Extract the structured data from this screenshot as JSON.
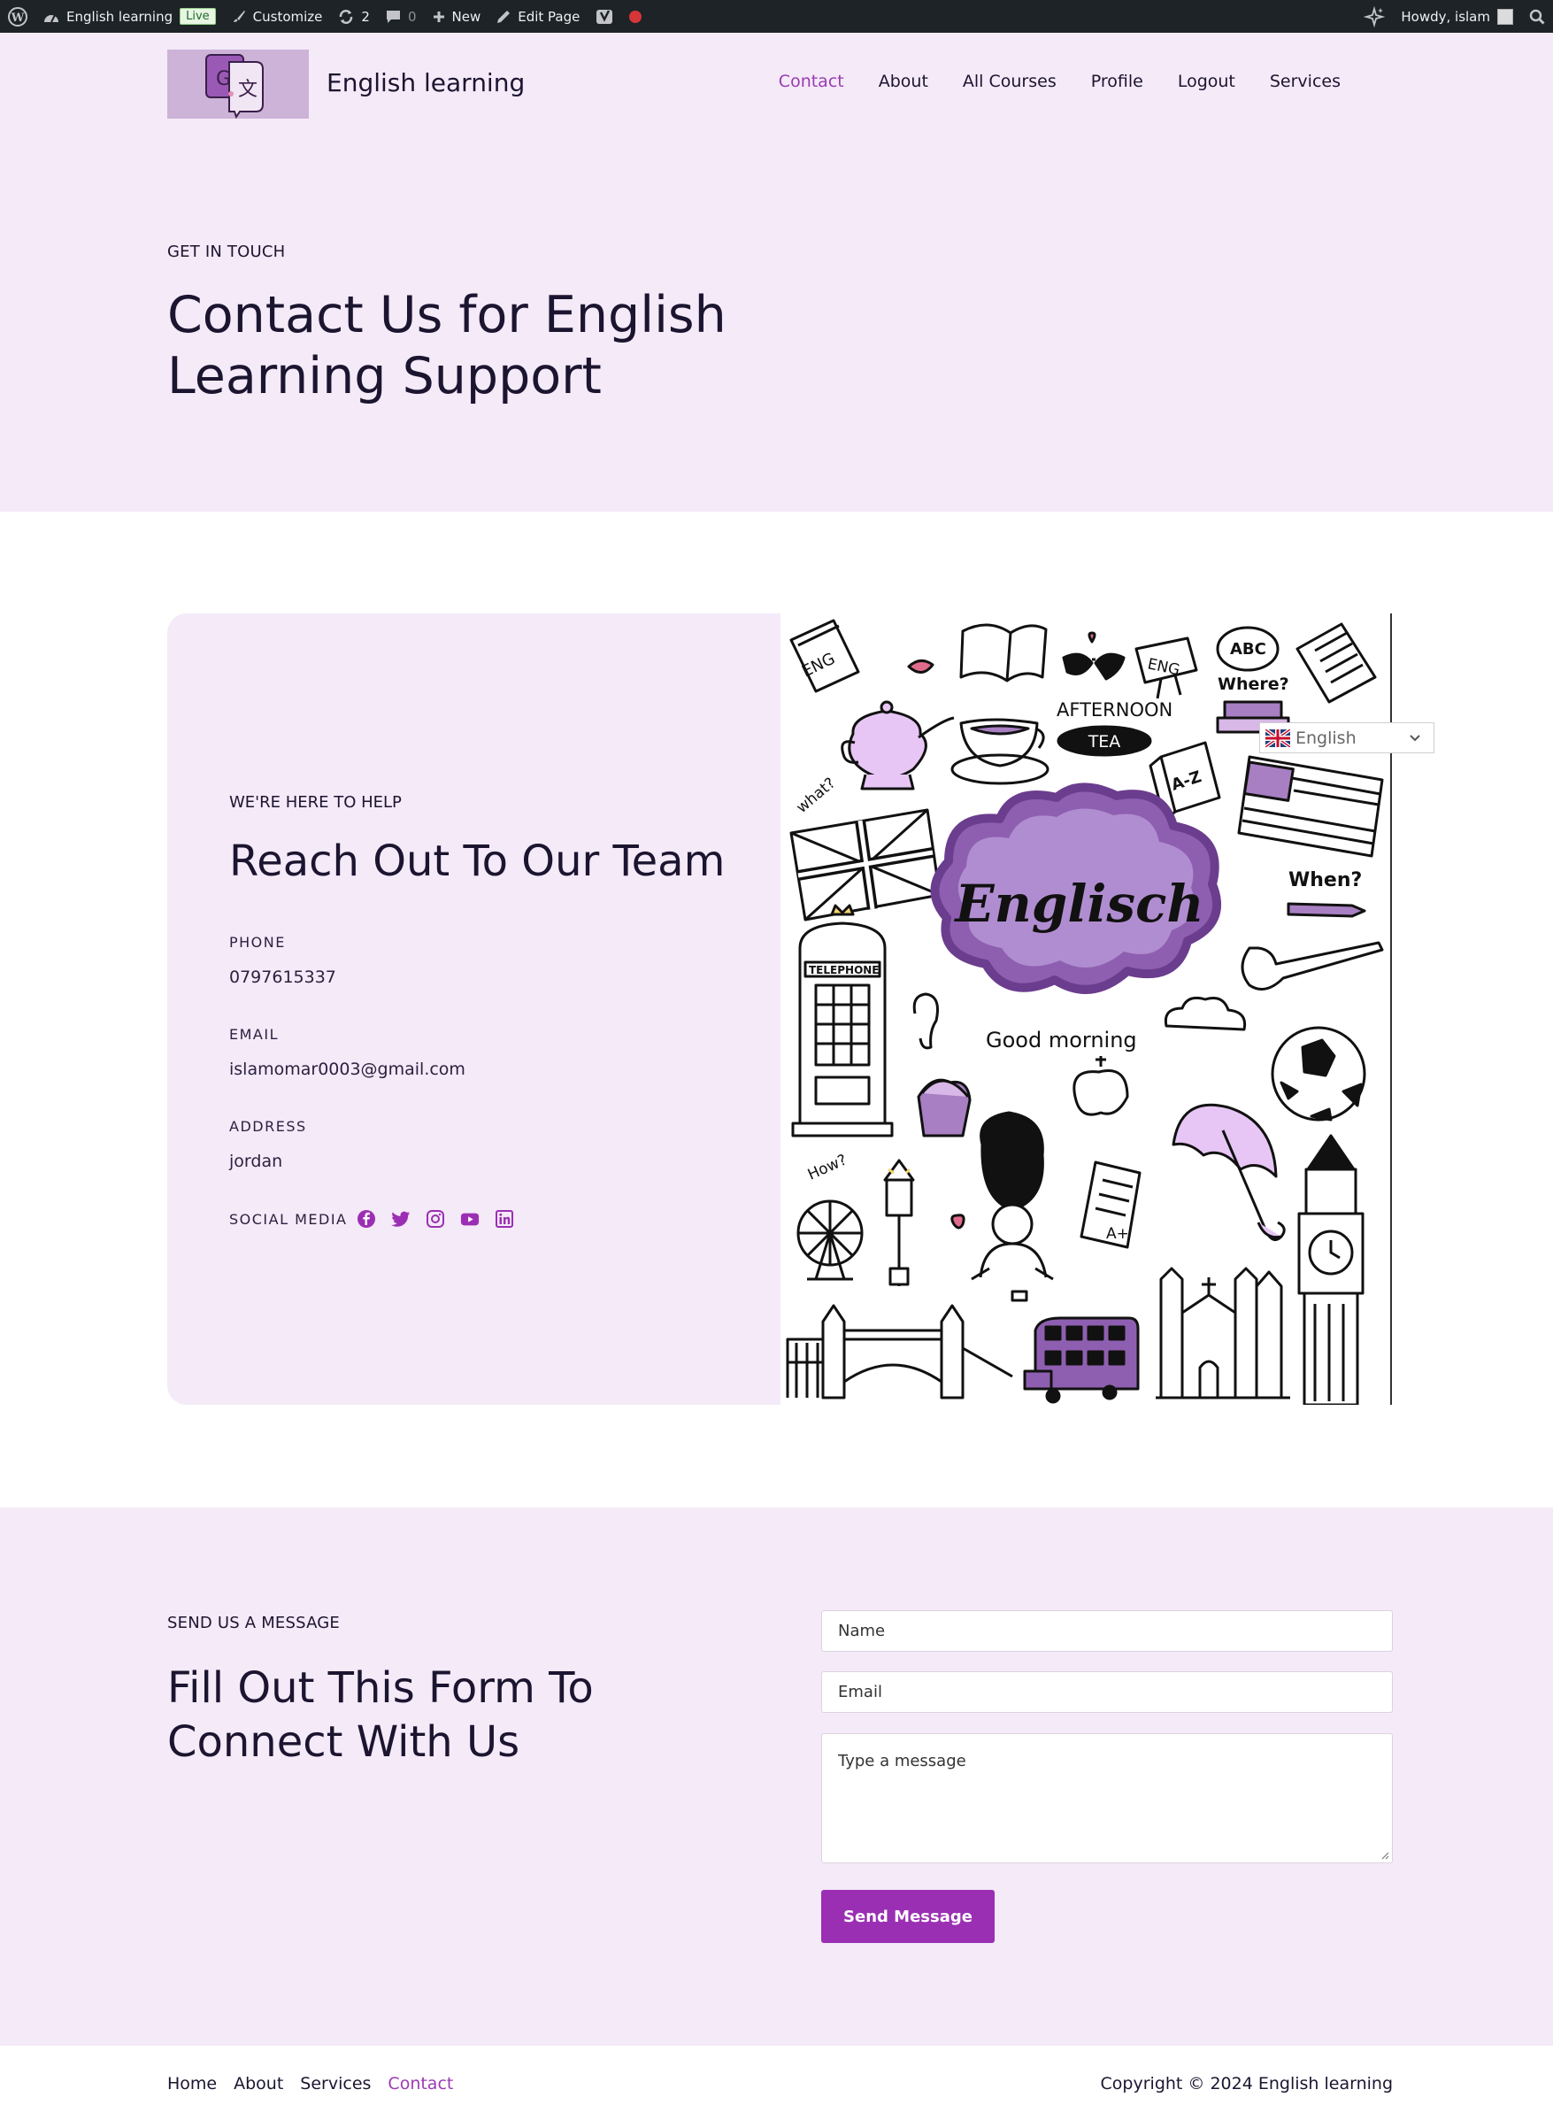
{
  "adminbar": {
    "site_name": "English learning",
    "live_badge": "Live",
    "customize": "Customize",
    "updates_count": "2",
    "comments_count": "0",
    "new_label": "New",
    "edit_page": "Edit Page",
    "howdy": "Howdy, islam"
  },
  "header": {
    "site_title": "English learning",
    "nav": [
      "Contact",
      "About",
      "All Courses",
      "Profile",
      "Logout",
      "Services"
    ],
    "active_nav": "Contact"
  },
  "hero": {
    "eyebrow": "GET IN TOUCH",
    "title": "Contact Us for English Learning Support"
  },
  "contact_card": {
    "eyebrow": "WE'RE HERE TO HELP",
    "title": "Reach Out To Our Team",
    "phone_label": "PHONE",
    "phone": "0797615337",
    "email_label": "EMAIL",
    "email": "islamomar0003@gmail.com",
    "address_label": "ADDRESS",
    "address": "jordan",
    "social_label": "SOCIAL MEDIA",
    "social_icons": [
      "facebook-icon",
      "twitter-icon",
      "instagram-icon",
      "youtube-icon",
      "linkedin-icon"
    ],
    "illustration_text": {
      "center": "Englisch",
      "afternoon": "AFTERNOON",
      "tea": "TEA",
      "eng": "ENG",
      "abc": "ABC",
      "where": "Where?",
      "what": "what?",
      "when": "When?",
      "az": "A-Z",
      "telephone": "TELEPHONE",
      "good_morning": "Good morning",
      "how": "How?",
      "grade": "A+"
    }
  },
  "language_switcher": {
    "selected": "English"
  },
  "message": {
    "eyebrow": "SEND US A MESSAGE",
    "title": "Fill Out This Form To Connect With Us",
    "name_placeholder": "Name",
    "email_placeholder": "Email",
    "message_placeholder": "Type a message",
    "send_label": "Send Message"
  },
  "footer": {
    "nav": [
      "Home",
      "About",
      "Services",
      "Contact"
    ],
    "active_nav": "Contact",
    "copyright": "Copyright © 2024 English learning"
  },
  "colors": {
    "accent": "#9b2fb3",
    "accent_text": "#9b3bb4",
    "lavender_bg": "#f4eaf8",
    "adminbar": "#1d2327"
  }
}
